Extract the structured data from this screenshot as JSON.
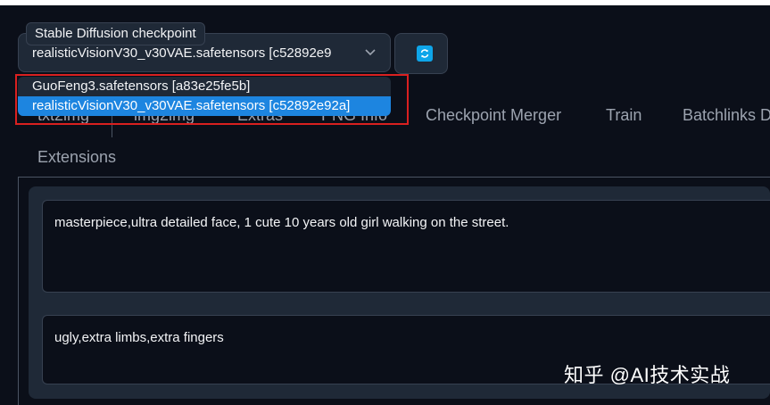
{
  "checkpoint": {
    "label": "Stable Diffusion checkpoint",
    "value": "realisticVisionV30_v30VAE.safetensors [c52892e9",
    "options": [
      "GuoFeng3.safetensors [a83e25fe5b]",
      "realisticVisionV30_v30VAE.safetensors [c52892e92a]"
    ],
    "selected_index": 1,
    "refresh_icon": "refresh-icon"
  },
  "tabs": {
    "items": [
      "txt2img",
      "img2img",
      "Extras",
      "PNG Info",
      "Checkpoint Merger",
      "Train",
      "Batchlinks D",
      "Extensions"
    ]
  },
  "prompts": {
    "positive": "masterpiece,ultra detailed face, 1 cute 10 years old girl walking on the street.",
    "negative": "ugly,extra limbs,extra fingers"
  },
  "watermark": "知乎 @AI技术实战",
  "colors": {
    "background": "#0b0f19",
    "panel": "#1f2937",
    "selected_option": "#1d85e0",
    "highlight_box": "#d92020",
    "refresh_accent": "#0ea5e9"
  }
}
